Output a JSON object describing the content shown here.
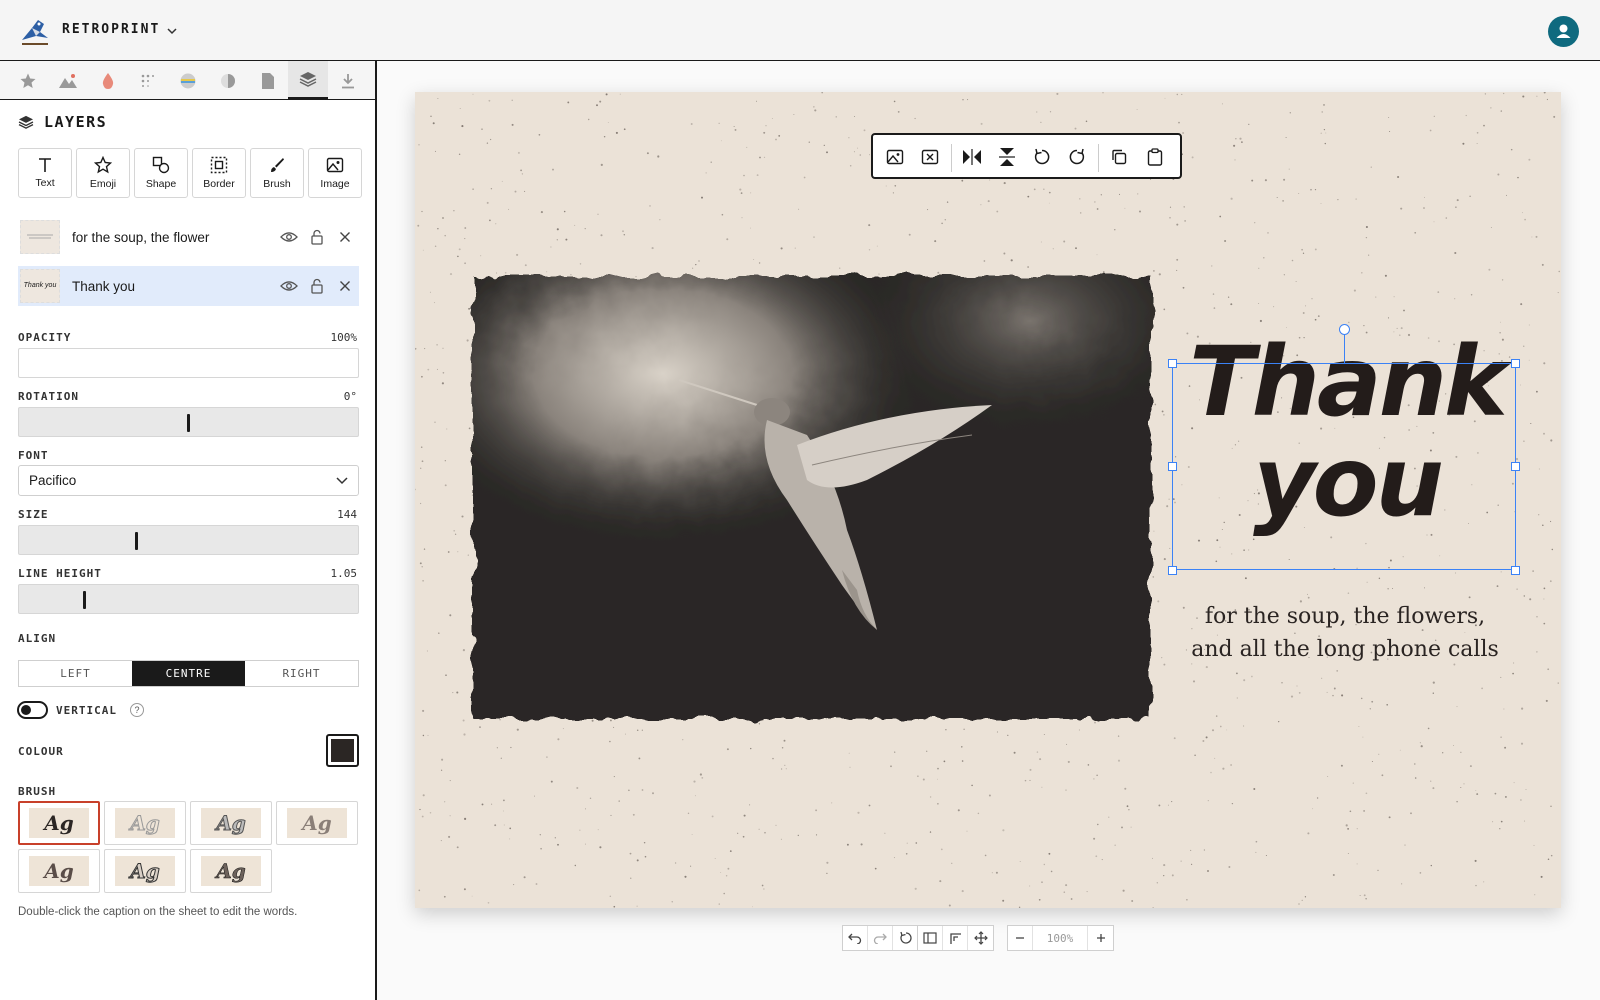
{
  "app": {
    "brand": "RETROPRINT"
  },
  "layers_panel": {
    "title": "LAYERS",
    "add_buttons": [
      {
        "label": "Text",
        "icon": "text-icon"
      },
      {
        "label": "Emoji",
        "icon": "star-icon"
      },
      {
        "label": "Shape",
        "icon": "shape-icon"
      },
      {
        "label": "Border",
        "icon": "border-icon"
      },
      {
        "label": "Brush",
        "icon": "brush-icon"
      },
      {
        "label": "Image",
        "icon": "image-icon"
      }
    ],
    "layers": [
      {
        "name": "for the soup, the flower",
        "selected": false
      },
      {
        "name": "Thank you",
        "selected": true,
        "thumb": "Thank you"
      }
    ]
  },
  "properties": {
    "opacity": {
      "label": "OPACITY",
      "value": "100%",
      "fraction": 1.0
    },
    "rotation": {
      "label": "ROTATION",
      "value": "0°"
    },
    "font": {
      "label": "FONT",
      "value": "Pacifico"
    },
    "size": {
      "label": "SIZE",
      "value": "144"
    },
    "line_height": {
      "label": "LINE HEIGHT",
      "value": "1.05"
    },
    "align": {
      "label": "ALIGN",
      "options": [
        "LEFT",
        "CENTRE",
        "RIGHT"
      ],
      "selected": "CENTRE"
    },
    "vertical": {
      "label": "VERTICAL",
      "on": false,
      "help": "?"
    },
    "colour": {
      "label": "COLOUR",
      "value": "#2b2624"
    },
    "brush": {
      "label": "BRUSH",
      "sample": "Ag",
      "selected_index": 0
    },
    "hint": "Double-click the caption on the sheet to edit the words."
  },
  "canvas": {
    "headline_line1": "Thank",
    "headline_line2": "you",
    "subtitle_line1": "for the soup, the flowers,",
    "subtitle_line2": "and all the long phone calls",
    "zoom": "100%"
  },
  "colors": {
    "accent": "#3b82f6",
    "selected_row": "#e1ebfb",
    "paper": "#ebe2d7",
    "avatar": "#0f6a7f",
    "brush_active": "#c8402a"
  }
}
